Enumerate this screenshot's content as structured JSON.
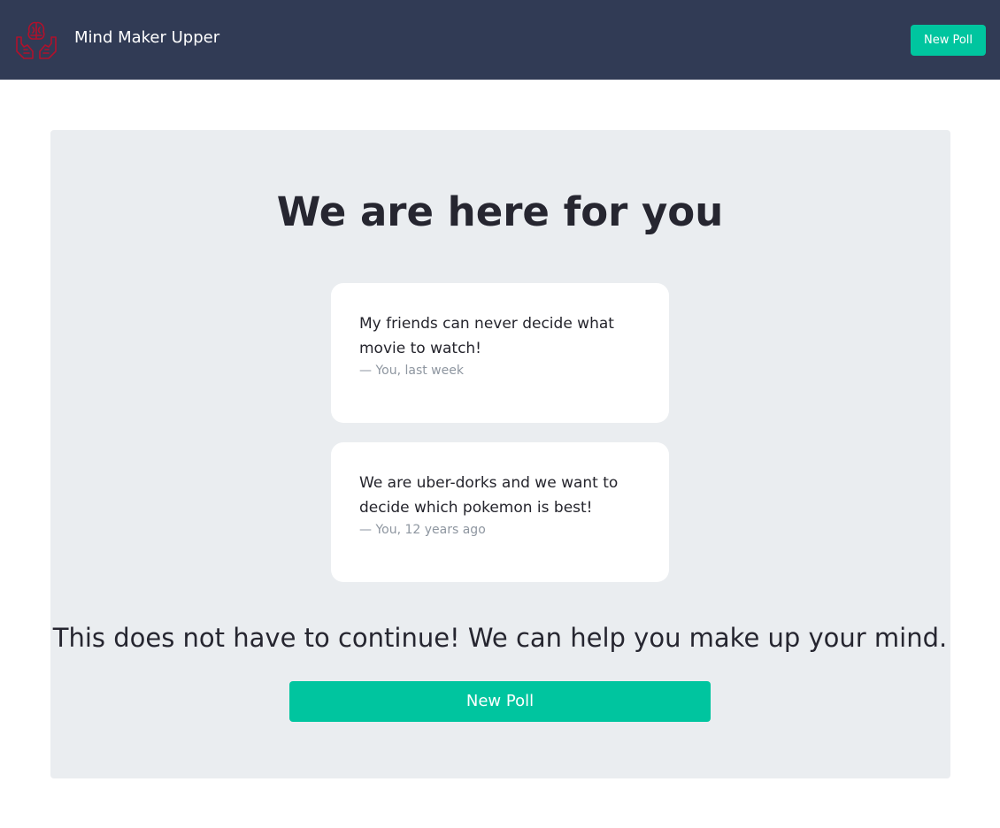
{
  "navbar": {
    "logo_icon": "hands-holding-brain-icon",
    "logo_color": "#b0112c",
    "brand": "Mind Maker Upper",
    "new_poll_label": "New Poll",
    "background": "#313b55",
    "accent": "#00c59f"
  },
  "hero": {
    "title": "We are here for you",
    "testimonials": [
      {
        "quote": "My friends can never decide what movie to watch!",
        "attribution": "— You, last week"
      },
      {
        "quote": "We are uber-dorks and we want to decide which pokemon is best!",
        "attribution": "— You, 12 years ago"
      }
    ],
    "tagline": "This does not have to continue! We can help you make up your mind.",
    "cta_label": "New Poll"
  }
}
